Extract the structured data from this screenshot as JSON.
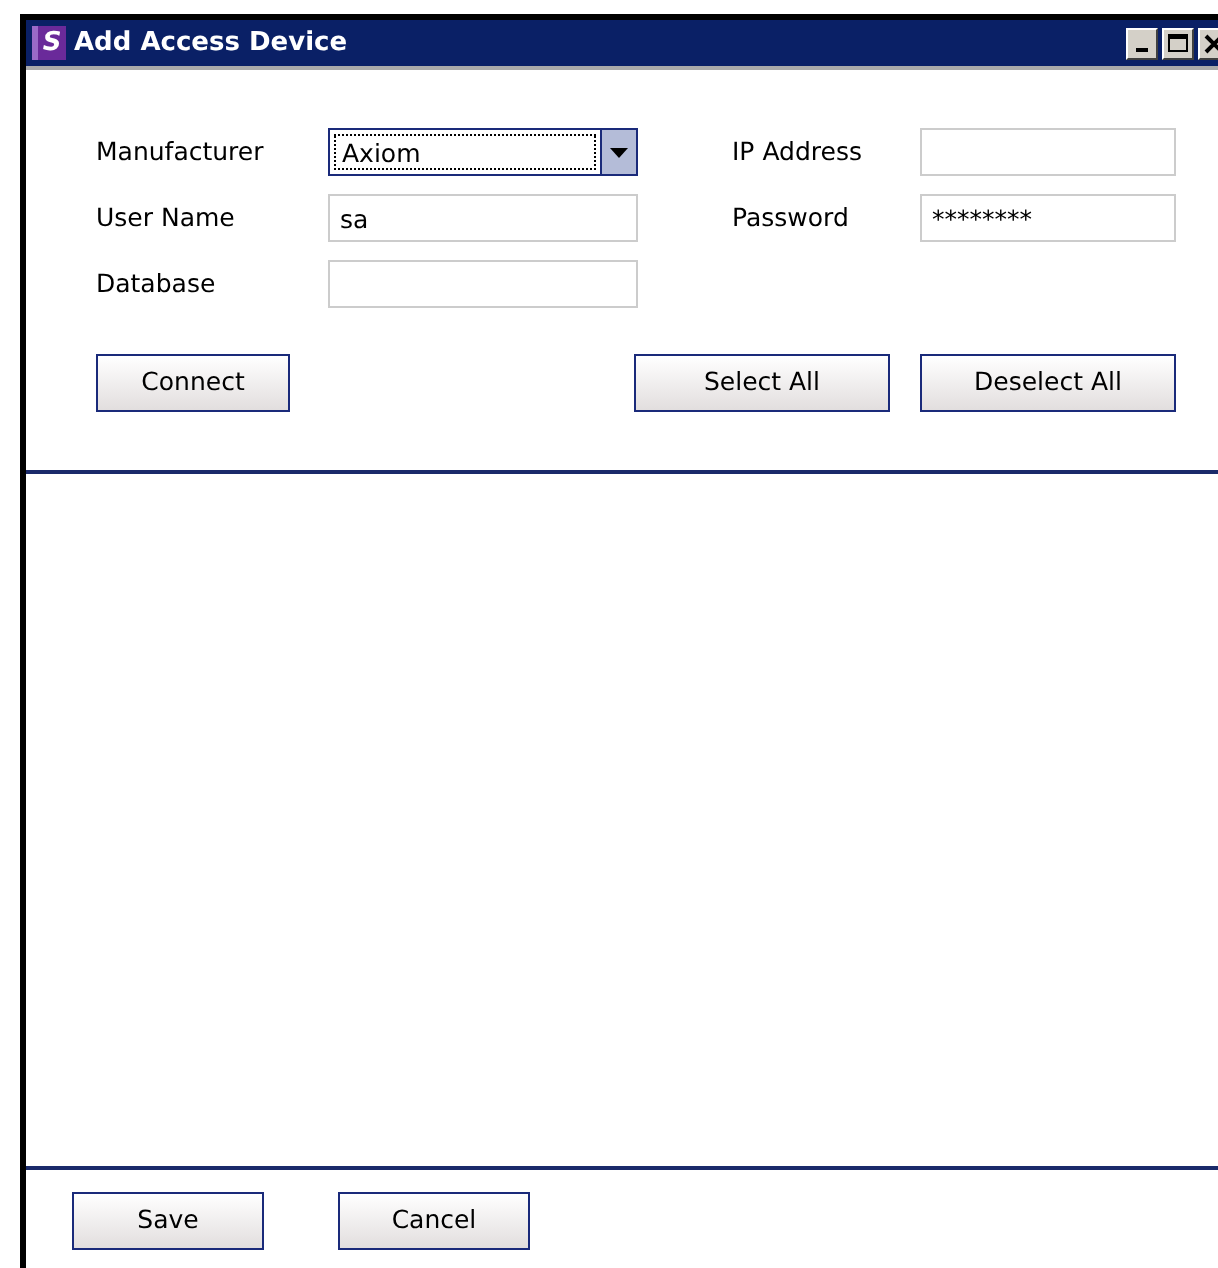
{
  "window": {
    "title": "Add Access Device",
    "icon_letter": "S"
  },
  "fields": [
    {
      "kind": "combo",
      "label": "Manufacturer",
      "value": "Axiom",
      "focused": true
    },
    {
      "kind": "text",
      "label": "IP Address"
    },
    {
      "kind": "text",
      "label": "User Name",
      "value": "sa"
    },
    {
      "kind": "text",
      "label": "Password",
      "value": "********"
    },
    {
      "kind": "text",
      "label": "Database"
    }
  ],
  "actions": [
    "Connect",
    "Select All",
    "Deselect All"
  ],
  "footer_buttons": [
    "Save",
    "Cancel"
  ]
}
